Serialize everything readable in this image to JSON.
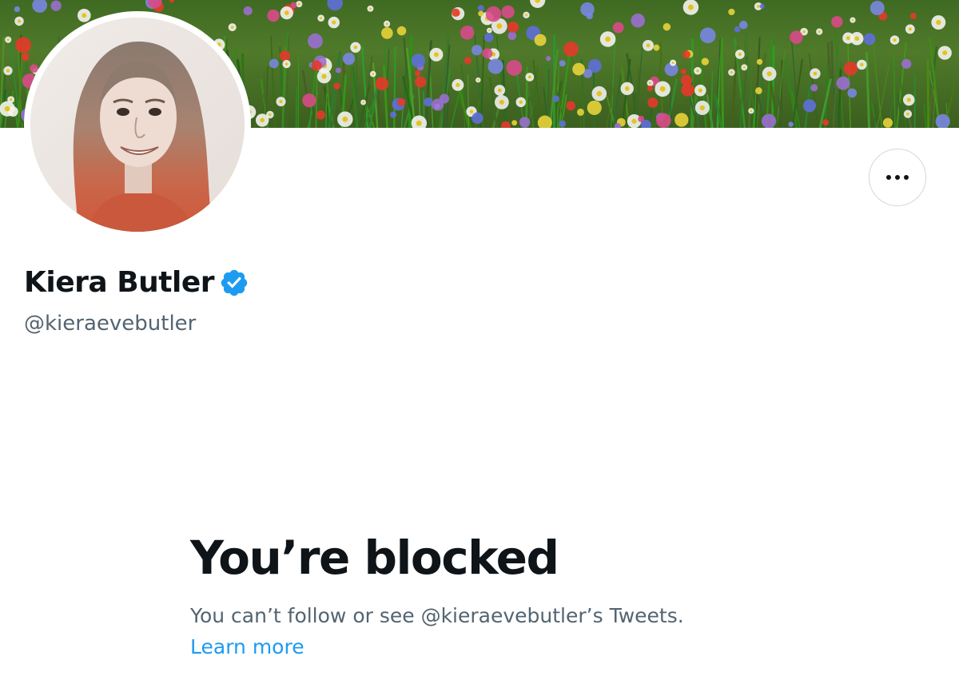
{
  "profile": {
    "name": "Kiera Butler",
    "handle": "@kieraevebutler",
    "verified_icon": "verified-badge-icon",
    "more_icon": "more-horizontal-icon"
  },
  "blocked": {
    "title": "You’re blocked",
    "message": "You can’t follow or see @kieraevebutler’s Tweets.",
    "link_label": "Learn more"
  },
  "colors": {
    "primary_text": "#0f1419",
    "secondary_text": "#536471",
    "link": "#1d9bf0",
    "verified": "#1d9bf0",
    "border": "#cfd9de"
  }
}
